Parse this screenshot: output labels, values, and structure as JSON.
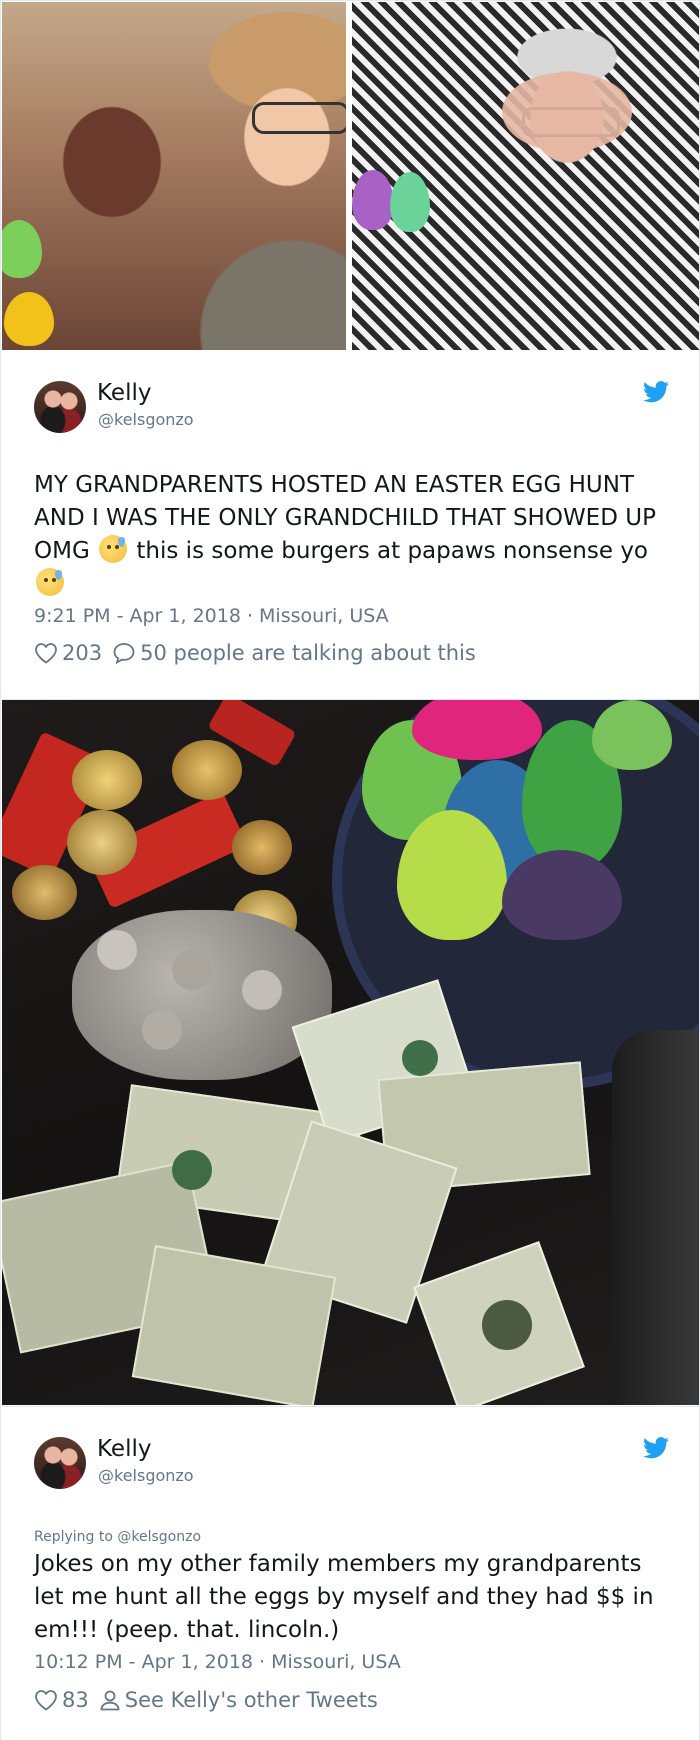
{
  "photos": {
    "top_left": "grandmother holding easter eggs",
    "top_right": "grandfather holding easter eggs",
    "middle": "candy, coins and dollar bills from easter eggs"
  },
  "tweet1": {
    "name": "Kelly",
    "handle": "@kelsgonzo",
    "text_part1": "MY GRANDPARENTS HOSTED AN EASTER EGG HUNT AND I WAS THE ONLY GRANDCHILD THAT SHOWED UP OMG ",
    "text_part2": " this is some burgers at papaws nonsense yo ",
    "timestamp": "9:21 PM - Apr 1, 2018 · Missouri, USA",
    "likes": "203",
    "replies_text": "50 people are talking about this"
  },
  "tweet2": {
    "name": "Kelly",
    "handle": "@kelsgonzo",
    "replying_to": "Replying to @kelsgonzo",
    "text": "Jokes on my other family members my grandparents let me hunt all the eggs by myself and they had $$ in em!!! (peep. that. lincoln.)",
    "timestamp": "10:12 PM - Apr 1, 2018 · Missouri, USA",
    "likes": "83",
    "profile_link": "See Kelly's other Tweets"
  },
  "colors": {
    "twitter_blue": "#1da1f2",
    "text_primary": "#14171a",
    "text_secondary": "#657786",
    "border": "#e1e8ed"
  }
}
